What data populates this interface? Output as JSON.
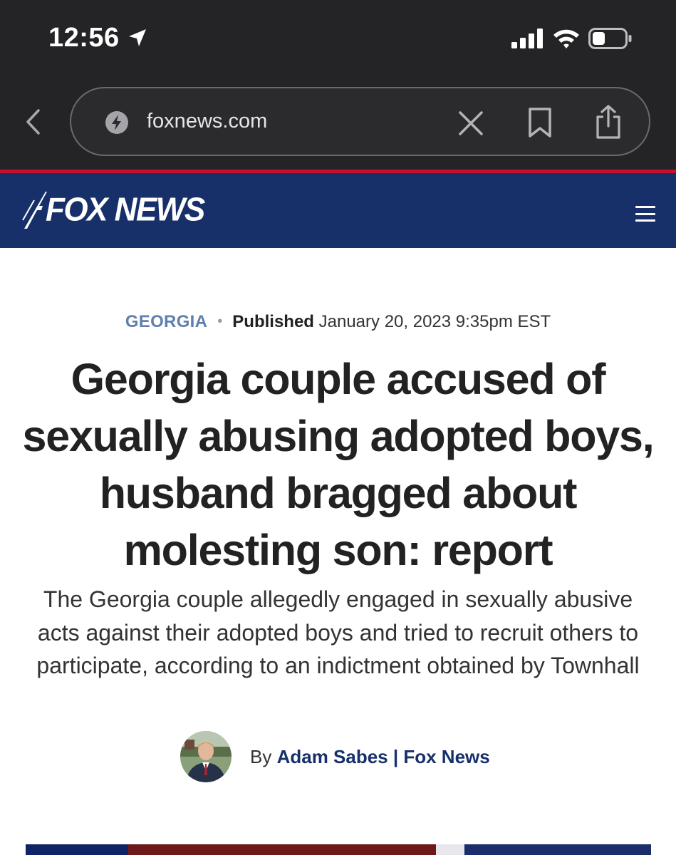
{
  "status_bar": {
    "time": "12:56"
  },
  "browser": {
    "url": "foxnews.com"
  },
  "site": {
    "logo_text": "FOX NEWS",
    "brand_blue": "#17306a",
    "brand_red": "#c8102e"
  },
  "article": {
    "category": "GEORGIA",
    "published_label": "Published",
    "published_date": "January 20, 2023 9:35pm EST",
    "headline": "Georgia couple accused of sexually abusing adopted boys, husband bragged about molesting son: report",
    "subhead": "The Georgia couple allegedly engaged in sexually abusive acts against their adopted boys and tried to recruit others to participate, according to an indictment obtained by Townhall",
    "byline_prefix": "By",
    "author": "Adam Sabes | Fox News"
  },
  "icons": {
    "location": "location-arrow-icon",
    "signal": "cellular-signal-icon",
    "wifi": "wifi-icon",
    "battery": "battery-icon",
    "back": "chevron-left-icon",
    "site_info": "bolt-icon",
    "clear": "close-icon",
    "bookmark": "bookmark-icon",
    "share": "share-icon",
    "menu": "hamburger-menu-icon"
  }
}
